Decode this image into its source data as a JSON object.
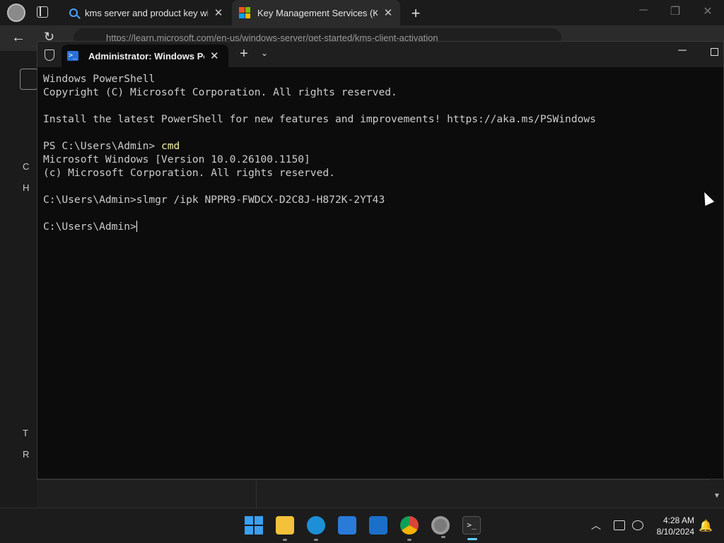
{
  "browser": {
    "tabs": [
      {
        "title": "kms server and product key windows",
        "icon": "search-icon"
      },
      {
        "title": "Key Management Services (KMS) client activation",
        "icon": "microsoft-logo-icon"
      }
    ],
    "url": "https://learn.microsoft.com/en-us/windows-server/get-started/kms-client-activation",
    "sidebar_labels": [
      "C",
      "H",
      "T",
      "R"
    ]
  },
  "terminal": {
    "tab_title": "Administrator: Windows PowerShell",
    "lines": [
      {
        "text": "Windows PowerShell"
      },
      {
        "text": "Copyright (C) Microsoft Corporation. All rights reserved."
      },
      {
        "text": ""
      },
      {
        "text": "Install the latest PowerShell for new features and improvements! https://aka.ms/PSWindows"
      },
      {
        "text": ""
      },
      {
        "prompt": "PS C:\\Users\\Admin> ",
        "cmd": "cmd"
      },
      {
        "text": "Microsoft Windows [Version 10.0.26100.1150]"
      },
      {
        "text": "(c) Microsoft Corporation. All rights reserved."
      },
      {
        "text": ""
      },
      {
        "text": "C:\\Users\\Admin>slmgr /ipk NPPR9-FWDCX-D2C8J-H872K-2YT43"
      },
      {
        "text": ""
      },
      {
        "text": "C:\\Users\\Admin>",
        "cursor": true
      }
    ]
  },
  "taskbar": {
    "apps": [
      {
        "name": "start-button",
        "icon": "windows-logo-icon"
      },
      {
        "name": "file-explorer",
        "icon": "folder-icon",
        "state": "running"
      },
      {
        "name": "edge",
        "icon": "edge-icon",
        "state": "running"
      },
      {
        "name": "microsoft-store",
        "icon": "store-icon"
      },
      {
        "name": "outlook",
        "icon": "outlook-icon"
      },
      {
        "name": "chrome",
        "icon": "chrome-icon",
        "state": "running"
      },
      {
        "name": "settings",
        "icon": "gear-icon",
        "state": "running"
      },
      {
        "name": "terminal",
        "icon": "terminal-icon",
        "state": "active"
      }
    ],
    "time": "4:28 AM",
    "date": "8/10/2024"
  },
  "colors": {
    "console_bg": "#0c0c0c",
    "console_text": "#cccccc",
    "command_text": "#f9f1a5",
    "accent": "#60cdff"
  }
}
